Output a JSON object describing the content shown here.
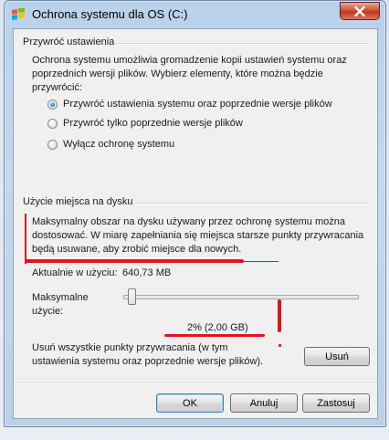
{
  "window": {
    "title": "Ochrona systemu dla OS (C:)"
  },
  "restore_section": {
    "title": "Przywróć ustawienia",
    "description": "Ochrona systemu umożliwia gromadzenie kopii ustawień systemu oraz poprzednich wersji plików. Wybierz elementy, które można będzie przywrócić:",
    "desc_line1": "Ochrona systemu umożliwia gromadzenie kopii ustawień systemu oraz",
    "desc_line2": "poprzednich wersji plików. Wybierz elementy, które można będzie",
    "desc_line3": "przywrócić:",
    "options": [
      {
        "label": "Przywróć ustawienia systemu oraz poprzednie wersje plików",
        "selected": true
      },
      {
        "label": "Przywróć tylko poprzednie wersje plików",
        "selected": false
      },
      {
        "label": "Wyłącz ochronę systemu",
        "selected": false
      }
    ]
  },
  "disk_section": {
    "title": "Użycie miejsca na dysku",
    "desc_line1": "Maksymalny obszar na dysku używany przez ochronę systemu można",
    "desc_line2": "dostosować. W miarę zapełniania się miejsca starsze punkty przywracania",
    "desc_line3": "będą usuwane, aby zrobić miejsce dla nowych.",
    "current_usage_label": "Aktualnie w użyciu:",
    "current_usage_value": "640,73 MB",
    "max_usage_label_line1": "Maksymalne",
    "max_usage_label_line2": "użycie:",
    "max_usage_percent": 2,
    "max_usage_readout": "2% (2,00 GB)",
    "delete_text_line1": "Usuń wszystkie punkty przywracania (w tym",
    "delete_text_line2": "ustawienia systemu oraz poprzednie wersje plików).",
    "delete_button": "Usuń"
  },
  "footer": {
    "ok": "OK",
    "cancel": "Anuluj",
    "apply": "Zastosuj"
  },
  "colors": {
    "annotation_red": "#e0141a",
    "accent_blue": "#3c7fb1"
  }
}
